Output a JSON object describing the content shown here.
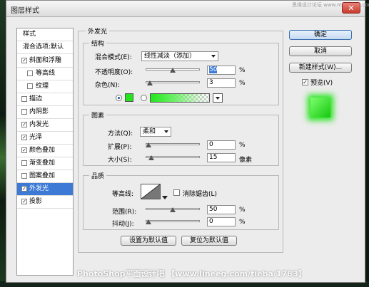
{
  "window": {
    "title": "图层样式",
    "close": "✕",
    "top_watermark": "思缘设计论坛 www.missvuan.com"
  },
  "styles_list": {
    "header": "样式",
    "blend_options": "混合选项:默认",
    "items": [
      {
        "label": "斜面和浮雕",
        "checked": true
      },
      {
        "label": "等高线",
        "checked": false
      },
      {
        "label": "纹理",
        "checked": false
      },
      {
        "label": "描边",
        "checked": false
      },
      {
        "label": "内阴影",
        "checked": false
      },
      {
        "label": "内发光",
        "checked": true
      },
      {
        "label": "光泽",
        "checked": true
      },
      {
        "label": "颜色叠加",
        "checked": true
      },
      {
        "label": "渐变叠加",
        "checked": false
      },
      {
        "label": "图案叠加",
        "checked": false
      },
      {
        "label": "外发光",
        "checked": true,
        "selected": true
      },
      {
        "label": "投影",
        "checked": true
      }
    ]
  },
  "outer_glow": {
    "title": "外发光",
    "structure": {
      "title": "结构",
      "blend_mode_label": "混合模式(E):",
      "blend_mode_value": "线性减淡（添加）",
      "opacity_label": "不透明度(O):",
      "opacity_value": "50",
      "opacity_level": 50,
      "noise_label": "杂色(N):",
      "noise_value": "3",
      "noise_level": 3,
      "unit_percent": "%",
      "glow_color": "#22e51c"
    },
    "elements": {
      "title": "图素",
      "method_label": "方法(Q):",
      "method_value": "柔和",
      "spread_label": "扩展(P):",
      "spread_value": "0",
      "spread_level": 0,
      "size_label": "大小(S):",
      "size_value": "15",
      "size_level": 6,
      "unit_percent": "%",
      "unit_pixels": "像素"
    },
    "quality": {
      "title": "品质",
      "contour_label": "等高线:",
      "anti_alias_label": "消除锯齿(L)",
      "range_label": "范围(R):",
      "range_value": "50",
      "range_level": 50,
      "jitter_label": "抖动(J):",
      "jitter_value": "0",
      "jitter_level": 0,
      "unit_percent": "%"
    },
    "make_default": "设置为默认值",
    "reset_default": "复位为默认值"
  },
  "buttons": {
    "ok": "确定",
    "cancel": "取消",
    "new_style": "新建样式(W)...",
    "preview": "预览(V)",
    "preview_checked": true
  },
  "watermark": "PhotoShop平面设计吧 【www.lineeg.com/tieba/1783】"
}
